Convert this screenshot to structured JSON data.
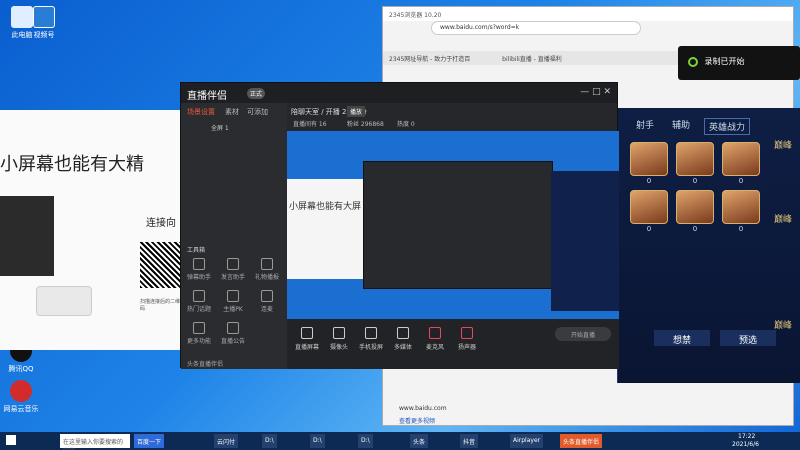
{
  "desktop": {
    "icons": [
      {
        "label": "此电脑"
      },
      {
        "label": "腾讯QQ"
      },
      {
        "label": "网易云音乐"
      }
    ],
    "tile_label": "视频号"
  },
  "browser": {
    "title": "2345浏览器 10.20",
    "url": "www.baidu.com/s?word=k",
    "tab_left": "2345网址导航 - 致力于打造百",
    "tab_right": "bilibili直播 - 直播福利",
    "bottom_text": "www.baidu.com",
    "bottom_link": "查看更多视频"
  },
  "recording": {
    "label": "录制已开始"
  },
  "game": {
    "tabs": [
      "射手",
      "辅助",
      "英雄战力"
    ],
    "heroes": [
      "0",
      "0",
      "0",
      "0",
      "0",
      "0"
    ],
    "side_labels": [
      "巅峰",
      "巅峰",
      "巅峰"
    ],
    "buttons": [
      "想禁",
      "预选"
    ]
  },
  "left_window": {
    "headline": "小屏幕也能有大精",
    "connect": "连接向",
    "qr_caption": "扫描连接后的二维码"
  },
  "app": {
    "logo": "直播伴侣",
    "badge": "正式",
    "side_tabs": [
      "场景设置",
      "素材",
      "可添加"
    ],
    "scene_label": "全屏 1",
    "live_title": "陪聊天室 / 开播 2400分",
    "status_chip": "播放",
    "stats": [
      "直播间有 16",
      "粉丝 296868",
      "热度 0"
    ],
    "toolbox_label": "工具箱",
    "tools": [
      "弹幕助手",
      "发言助手",
      "礼物播报",
      "热门话题",
      "主播PK",
      "连麦",
      "更多功能",
      "直播公告"
    ],
    "controls": [
      "直播屏幕",
      "摄像头",
      "手机投屏",
      "多媒体",
      "麦克风",
      "扬声器"
    ],
    "footer_note": "头条直播伴侣",
    "go_live": "开始直播",
    "preview_headline": "小屏幕也能有大屏"
  },
  "taskbar": {
    "search": "在这里输入你要搜索的内容",
    "items": [
      "百度一下",
      "云闪付",
      "D:\\",
      "D:\\",
      "D:\\",
      "头条",
      "抖音",
      "Airplayer",
      "头条直播伴侣"
    ],
    "time": "17:22",
    "date": "2021/6/6"
  }
}
